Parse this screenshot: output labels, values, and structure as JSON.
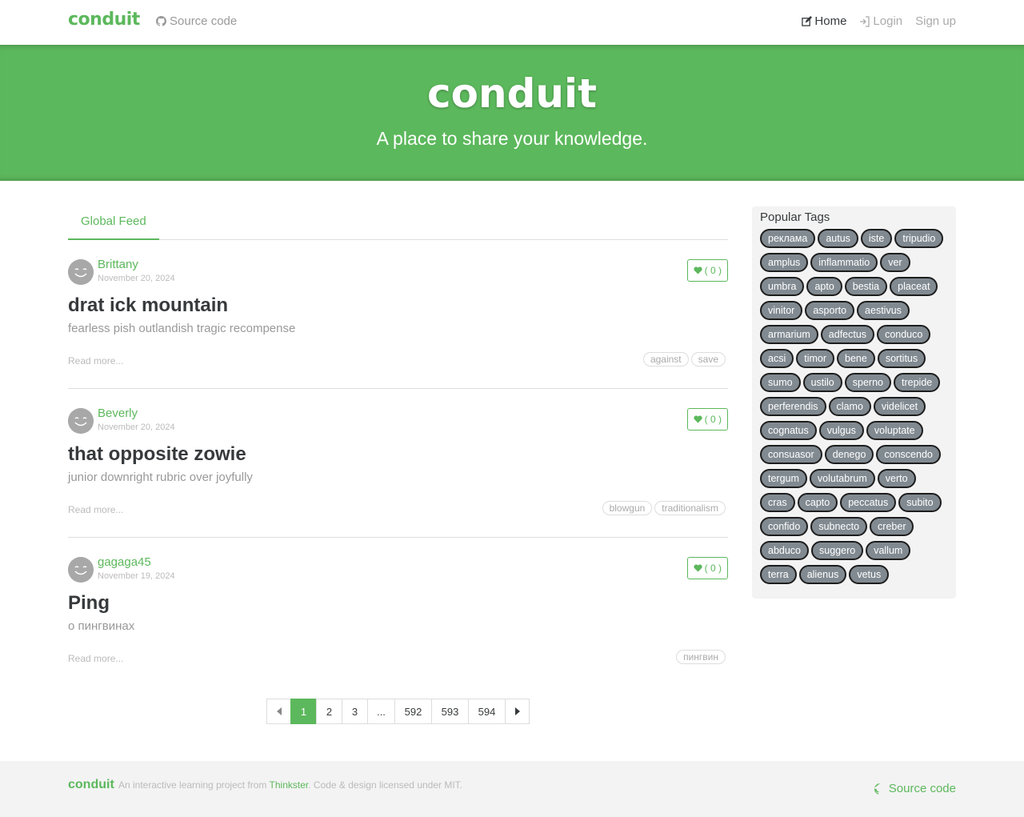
{
  "navbar": {
    "brand": "conduit",
    "source_code": "Source code",
    "links": [
      {
        "label": "Home",
        "icon": "edit-icon"
      },
      {
        "label": "Login",
        "icon": "login-icon"
      },
      {
        "label": "Sign up"
      }
    ]
  },
  "banner": {
    "title": "conduit",
    "subtitle": "A place to share your knowledge."
  },
  "feed": {
    "tab": "Global Feed",
    "articles": [
      {
        "author": "Brittany",
        "date": "November 20, 2024",
        "favorites": "( 0 )",
        "title": "drat ick mountain",
        "description": "fearless pish outlandish tragic recompense",
        "read_more": "Read more...",
        "tags": [
          "against",
          "save"
        ]
      },
      {
        "author": "Beverly",
        "date": "November 20, 2024",
        "favorites": "( 0 )",
        "title": "that opposite zowie",
        "description": "junior downright rubric over joyfully",
        "read_more": "Read more...",
        "tags": [
          "blowgun",
          "traditionalism"
        ]
      },
      {
        "author": "gagaga45",
        "date": "November 19, 2024",
        "favorites": "( 0 )",
        "title": "Ping",
        "description": "о пингвинах",
        "read_more": "Read more...",
        "tags": [
          "пингвин"
        ]
      }
    ]
  },
  "pagination": {
    "pages": [
      "1",
      "2",
      "3",
      "...",
      "592",
      "593",
      "594"
    ],
    "current": "1"
  },
  "sidebar": {
    "title": "Popular Tags",
    "tags": [
      "реклама",
      "autus",
      "iste",
      "tripudio",
      "amplus",
      "inflammatio",
      "ver",
      "umbra",
      "apto",
      "bestia",
      "placeat",
      "vinitor",
      "asporto",
      "aestivus",
      "armarium",
      "adfectus",
      "conduco",
      "acsi",
      "timor",
      "bene",
      "sortitus",
      "sumo",
      "ustilo",
      "sperno",
      "trepide",
      "perferendis",
      "clamo",
      "videlicet",
      "cognatus",
      "vulgus",
      "voluptate",
      "consuasor",
      "denego",
      "conscendo",
      "tergum",
      "volutabrum",
      "verto",
      "cras",
      "capto",
      "peccatus",
      "subito",
      "confido",
      "subnecto",
      "creber",
      "abduco",
      "suggero",
      "vallum",
      "terra",
      "alienus",
      "vetus"
    ]
  },
  "footer": {
    "brand": "conduit",
    "text_before": "An interactive learning project from ",
    "link": "Thinkster",
    "text_after": ". Code & design licensed under MIT.",
    "source_code": "Source code"
  },
  "colors": {
    "accent": "#5cb85c",
    "tag_pill_bg": "#818a91",
    "muted_text": "#bbbbbb"
  }
}
